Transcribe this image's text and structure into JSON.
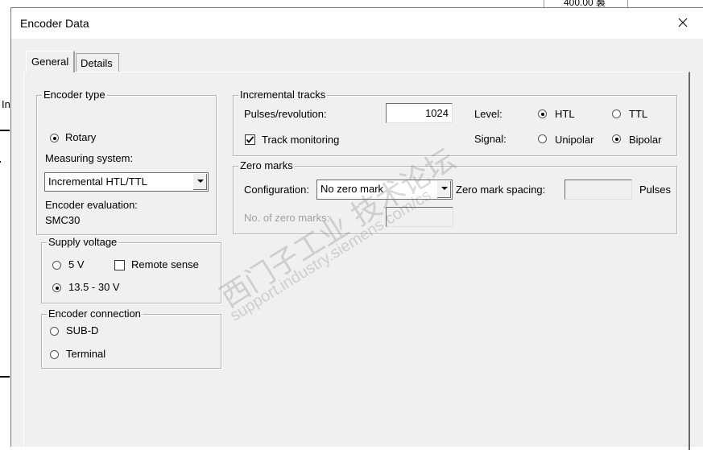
{
  "background": {
    "top_fragment": "400.00 裠",
    "left_fragment": "In"
  },
  "dialog": {
    "title": "Encoder Data",
    "close_glyph": "✕"
  },
  "tabs": [
    {
      "label": "General",
      "active": true
    },
    {
      "label": "Details",
      "active": false
    }
  ],
  "encoder_type": {
    "legend": "Encoder type",
    "rotary_label": "Rotary",
    "rotary_selected": true,
    "measuring_system_label": "Measuring system:",
    "measuring_system_value": "Incremental HTL/TTL",
    "evaluation_label": "Encoder evaluation:",
    "evaluation_value": "SMC30"
  },
  "supply_voltage": {
    "legend": "Supply voltage",
    "opt_5v": "5 V",
    "opt_5v_selected": false,
    "remote_sense": "Remote sense",
    "remote_sense_checked": false,
    "opt_13v": "13.5 - 30 V",
    "opt_13v_selected": true
  },
  "encoder_connection": {
    "legend": "Encoder connection",
    "opt_subd": "SUB-D",
    "opt_subd_selected": false,
    "opt_terminal": "Terminal",
    "opt_terminal_selected": false
  },
  "incremental_tracks": {
    "legend": "Incremental tracks",
    "pulses_label": "Pulses/revolution:",
    "pulses_value": "1024",
    "track_monitoring": "Track monitoring",
    "track_monitoring_checked": true,
    "level_label": "Level:",
    "level_htl": "HTL",
    "level_htl_selected": true,
    "level_ttl": "TTL",
    "level_ttl_selected": false,
    "signal_label": "Signal:",
    "signal_unipolar": "Unipolar",
    "signal_unipolar_selected": false,
    "signal_bipolar": "Bipolar",
    "signal_bipolar_selected": true
  },
  "zero_marks": {
    "legend": "Zero marks",
    "configuration_label": "Configuration:",
    "configuration_value": "No zero mark",
    "spacing_label": "Zero mark spacing:",
    "spacing_value": "",
    "spacing_unit": "Pulses",
    "count_label": "No. of zero marks:",
    "count_value": ""
  },
  "watermark": {
    "line1": "西门子工业  技术论坛",
    "line2": "support.industry.siemens.com/cs"
  },
  "colors": {
    "dialog_bg": "#f0f0f0",
    "titlebar_bg": "#ffffff",
    "watermark": "#787878"
  }
}
